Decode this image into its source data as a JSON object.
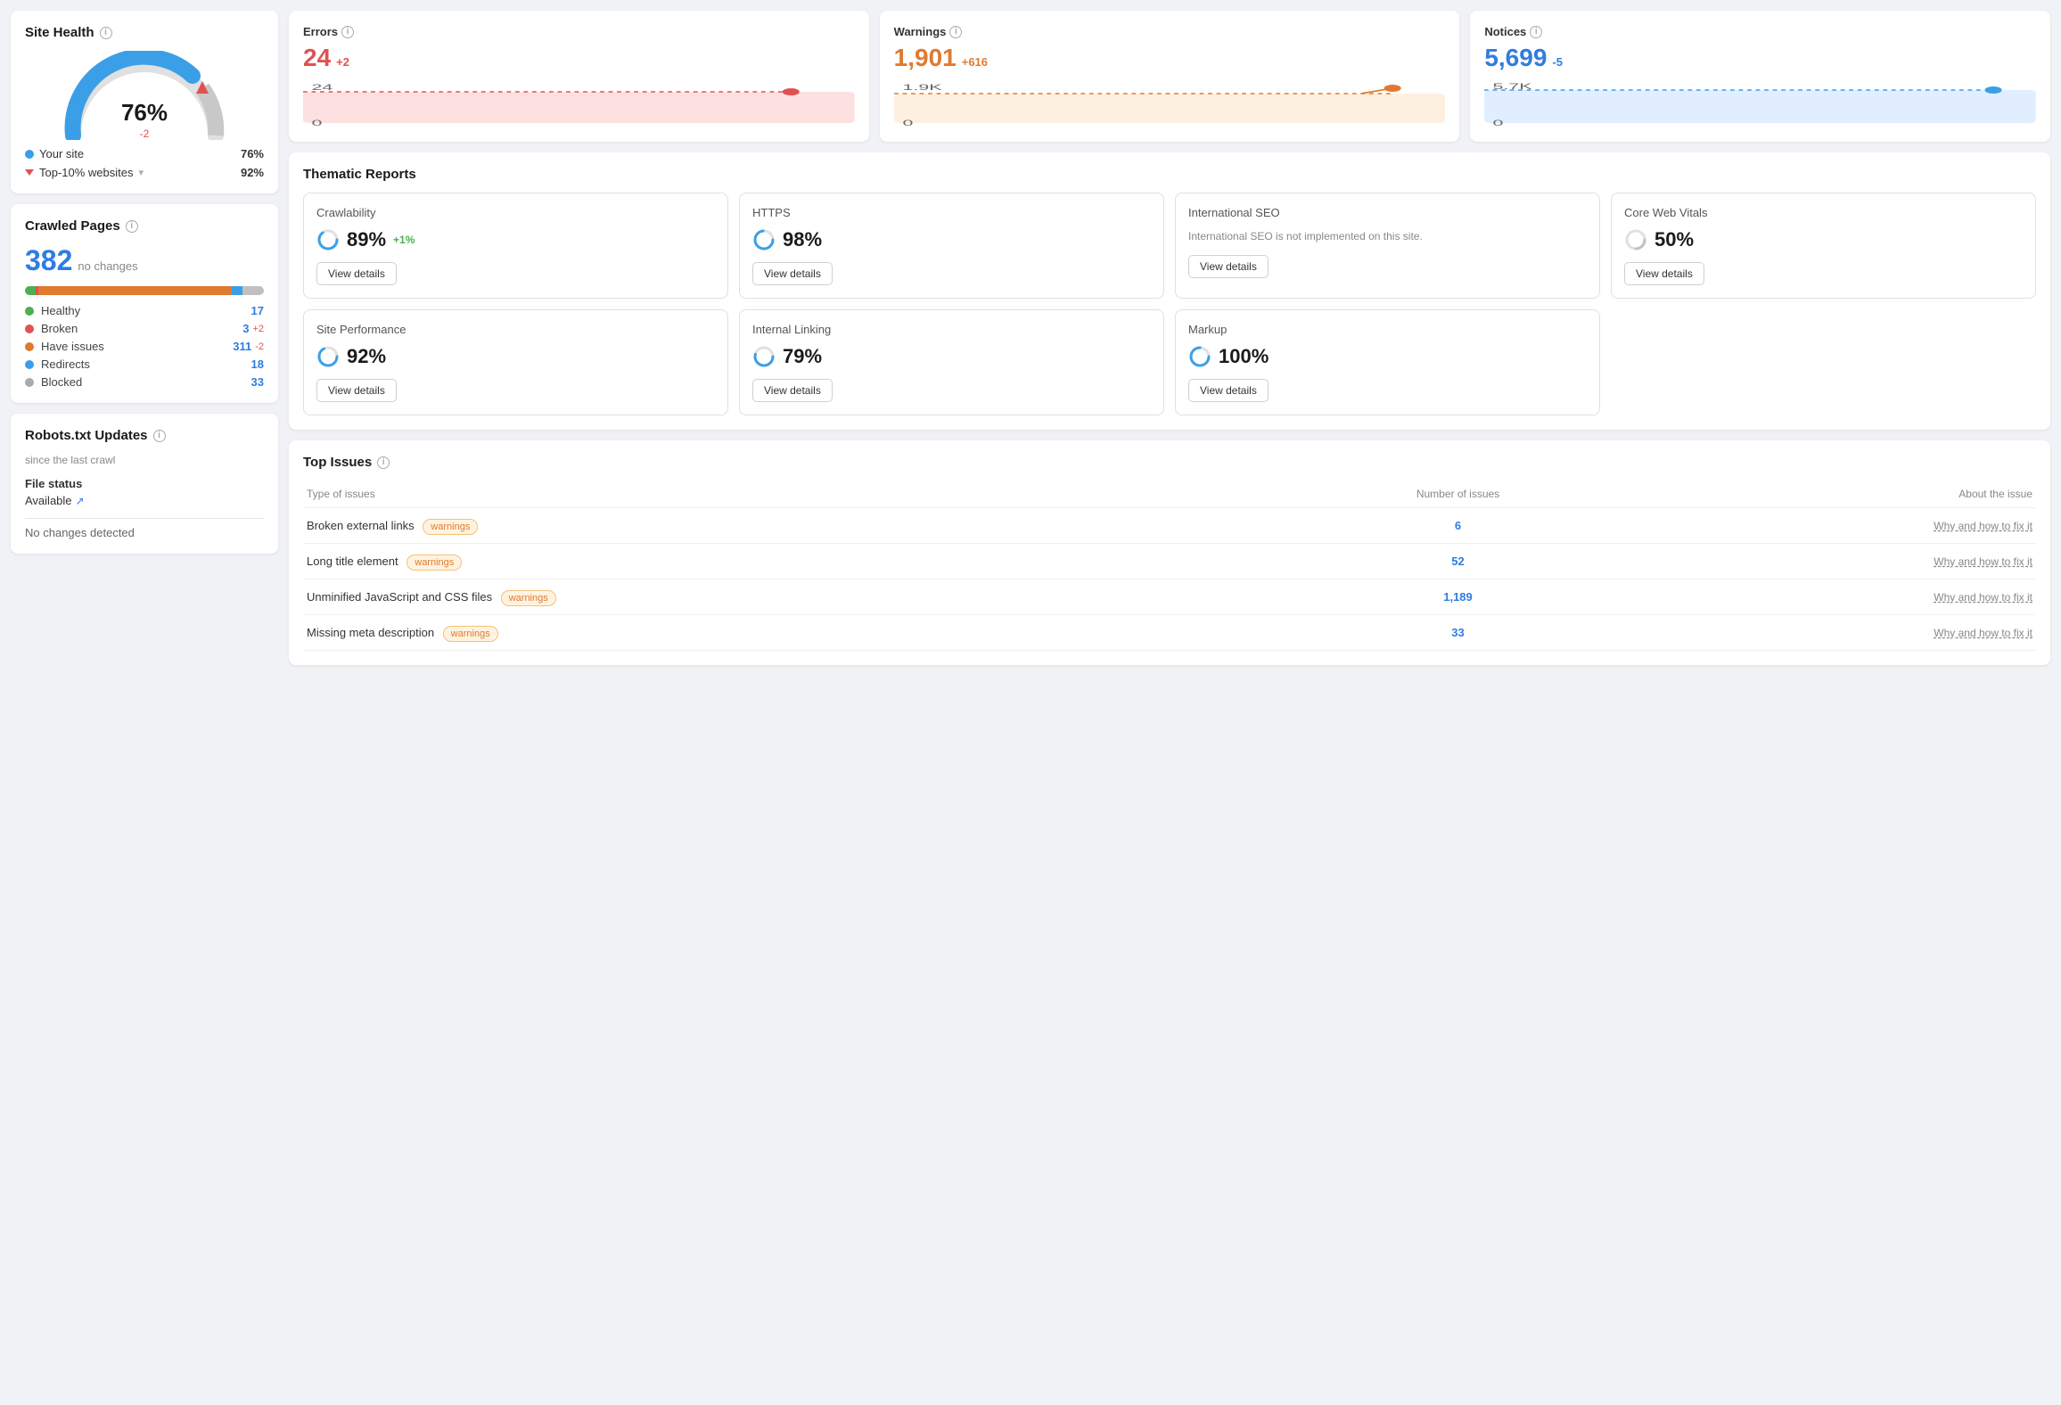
{
  "siteHealth": {
    "title": "Site Health",
    "percent": "76%",
    "change": "-2",
    "yourSiteLabel": "Your site",
    "yourSiteValue": "76%",
    "topSitesLabel": "Top-10% websites",
    "topSitesValue": "92%",
    "yourSiteColor": "#3b9fe8",
    "topSitesColor": "#e05252"
  },
  "crawledPages": {
    "title": "Crawled Pages",
    "count": "382",
    "noChanges": "no changes",
    "items": [
      {
        "label": "Healthy",
        "color": "#4caf50",
        "value": "17",
        "change": ""
      },
      {
        "label": "Broken",
        "color": "#e05252",
        "value": "3",
        "change": "+2"
      },
      {
        "label": "Have issues",
        "color": "#e07a2f",
        "value": "311",
        "change": "-2"
      },
      {
        "label": "Redirects",
        "color": "#3b9fe8",
        "value": "18",
        "change": ""
      },
      {
        "label": "Blocked",
        "color": "#aaaaaa",
        "value": "33",
        "change": ""
      }
    ]
  },
  "robots": {
    "title": "Robots.txt Updates",
    "subtitle": "since the last crawl",
    "fileStatusLabel": "File status",
    "fileStatusValue": "Available",
    "noChanges": "No changes detected"
  },
  "metrics": [
    {
      "label": "Errors",
      "value": "24",
      "change": "+2",
      "colorClass": "red",
      "chartMin": "0",
      "chartMax": "24",
      "chartColor": "#fde0e0",
      "chartLineColor": "#e05252"
    },
    {
      "label": "Warnings",
      "value": "1,901",
      "change": "+616",
      "colorClass": "orange",
      "chartMin": "0",
      "chartMax": "1.9K",
      "chartColor": "#fef0e0",
      "chartLineColor": "#e07a2f"
    },
    {
      "label": "Notices",
      "value": "5,699",
      "change": "-5",
      "colorClass": "blue",
      "chartMin": "0",
      "chartMax": "5.7K",
      "chartColor": "#e0eeff",
      "chartLineColor": "#3b9fe8"
    }
  ],
  "thematicReports": {
    "title": "Thematic Reports",
    "items": [
      {
        "name": "Crawlability",
        "score": "89%",
        "change": "+1%",
        "note": "",
        "hasDetails": true,
        "color": "#3b9fe8",
        "pct": 89
      },
      {
        "name": "HTTPS",
        "score": "98%",
        "change": "",
        "note": "",
        "hasDetails": true,
        "color": "#3b9fe8",
        "pct": 98
      },
      {
        "name": "International SEO",
        "score": "",
        "change": "",
        "note": "International SEO is not implemented on this site.",
        "hasDetails": true,
        "color": "#cccccc",
        "pct": 0
      },
      {
        "name": "Core Web Vitals",
        "score": "50%",
        "change": "",
        "note": "",
        "hasDetails": true,
        "color": "#cccccc",
        "pct": 50
      },
      {
        "name": "Site Performance",
        "score": "92%",
        "change": "",
        "note": "",
        "hasDetails": true,
        "color": "#3b9fe8",
        "pct": 92
      },
      {
        "name": "Internal Linking",
        "score": "79%",
        "change": "",
        "note": "",
        "hasDetails": true,
        "color": "#3b9fe8",
        "pct": 79
      },
      {
        "name": "Markup",
        "score": "100%",
        "change": "",
        "note": "",
        "hasDetails": true,
        "color": "#3b9fe8",
        "pct": 100
      }
    ],
    "viewDetailsLabel": "View details"
  },
  "topIssues": {
    "title": "Top Issues",
    "columns": [
      "Type of issues",
      "Number of issues",
      "About the issue"
    ],
    "rows": [
      {
        "type": "Broken external links",
        "badge": "warnings",
        "count": "6",
        "fix": "Why and how to fix it"
      },
      {
        "type": "Long title element",
        "badge": "warnings",
        "count": "52",
        "fix": "Why and how to fix it"
      },
      {
        "type": "Unminified JavaScript and CSS files",
        "badge": "warnings",
        "count": "1,189",
        "fix": "Why and how to fix it"
      },
      {
        "type": "Missing meta description",
        "badge": "warnings",
        "count": "33",
        "fix": "Why and how to fix it"
      }
    ]
  }
}
